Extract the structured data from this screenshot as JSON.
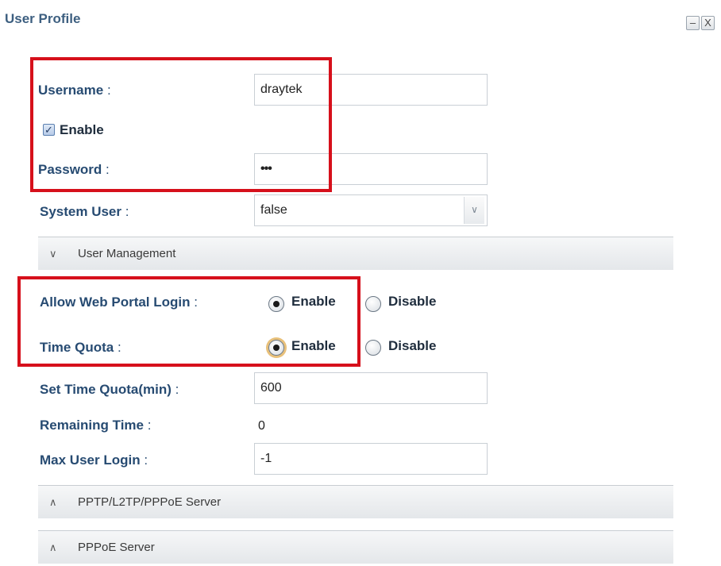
{
  "window": {
    "title": "User Profile",
    "minimize_icon": "minimize-icon",
    "close_icon": "close-icon",
    "minimize_glyph": "–",
    "close_glyph": "X"
  },
  "form": {
    "username": {
      "label": "Username",
      "sep": ":",
      "value": "draytek"
    },
    "enable": {
      "label": "Enable",
      "checked": true,
      "icon": "checkbox-icon"
    },
    "password": {
      "label": "Password",
      "sep": ":",
      "value": "•••"
    },
    "system_user": {
      "label": "System User",
      "sep": ":",
      "value": "false",
      "icon": "chevron-down-icon"
    }
  },
  "sections": {
    "user_management": {
      "label": "User Management",
      "state": "expanded",
      "icon": "chevron-down-icon",
      "glyph": "∨"
    },
    "pptp": {
      "label": "PPTP/L2TP/PPPoE Server",
      "state": "collapsed",
      "icon": "chevron-up-icon",
      "glyph": "∧"
    },
    "pppoe": {
      "label": "PPPoE Server",
      "state": "collapsed",
      "icon": "chevron-up-icon",
      "glyph": "∧"
    }
  },
  "user_management": {
    "allow_web_portal_login": {
      "label": "Allow Web Portal Login",
      "sep": ":",
      "options": [
        "Enable",
        "Disable"
      ],
      "selected": "Enable"
    },
    "time_quota": {
      "label": "Time Quota",
      "sep": ":",
      "options": [
        "Enable",
        "Disable"
      ],
      "selected": "Enable"
    },
    "set_time_quota": {
      "label": "Set Time Quota(min)",
      "sep": ":",
      "value": "600"
    },
    "remaining_time": {
      "label": "Remaining Time",
      "sep": ":",
      "value": "0"
    },
    "max_user_login": {
      "label": "Max User Login",
      "sep": ":",
      "value": "-1"
    }
  },
  "colors": {
    "highlight": "#d6101b",
    "label": "#274b72",
    "title": "#3d5f80"
  }
}
